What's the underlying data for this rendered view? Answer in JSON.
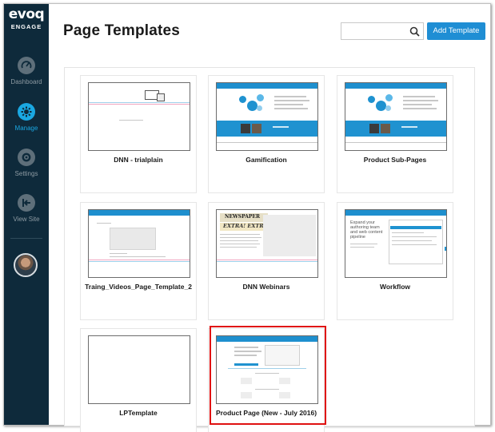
{
  "sidebar": {
    "logo": "evoq",
    "logo_sub": "ENGAGE",
    "items": [
      {
        "label": "Dashboard",
        "icon": "dashboard-gauge-icon",
        "active": false
      },
      {
        "label": "Manage",
        "icon": "manage-gear-icon",
        "active": true
      },
      {
        "label": "Settings",
        "icon": "settings-gear-icon",
        "active": false
      },
      {
        "label": "View Site",
        "icon": "view-site-exit-icon",
        "active": false
      }
    ],
    "avatar": "user-avatar"
  },
  "header": {
    "title": "Page Templates",
    "search_placeholder": "",
    "search_value": "",
    "add_button": "Add Template"
  },
  "templates": [
    {
      "name": "DNN - trialplain"
    },
    {
      "name": "Gamification"
    },
    {
      "name": "Product Sub-Pages"
    },
    {
      "name": "Traing_Videos_Page_Template_2"
    },
    {
      "name": "DNN Webinars"
    },
    {
      "name": "Workflow"
    },
    {
      "name": "LPTemplate"
    },
    {
      "name": "Product Page (New - July 2016)"
    }
  ],
  "thumbnail_text": {
    "webinar_badge": "NEWSPAPER",
    "webinar_headline": "EXTRA! EXTRA!",
    "workflow_heading_1": "Expand your",
    "workflow_heading_2": "authoring team",
    "workflow_heading_3": "and web content",
    "workflow_heading_4": "pipeline"
  },
  "colors": {
    "sidebar_bg": "#0e2a3b",
    "accent": "#1aa8e2",
    "button": "#1f8ed4",
    "highlight": "#e01010"
  }
}
